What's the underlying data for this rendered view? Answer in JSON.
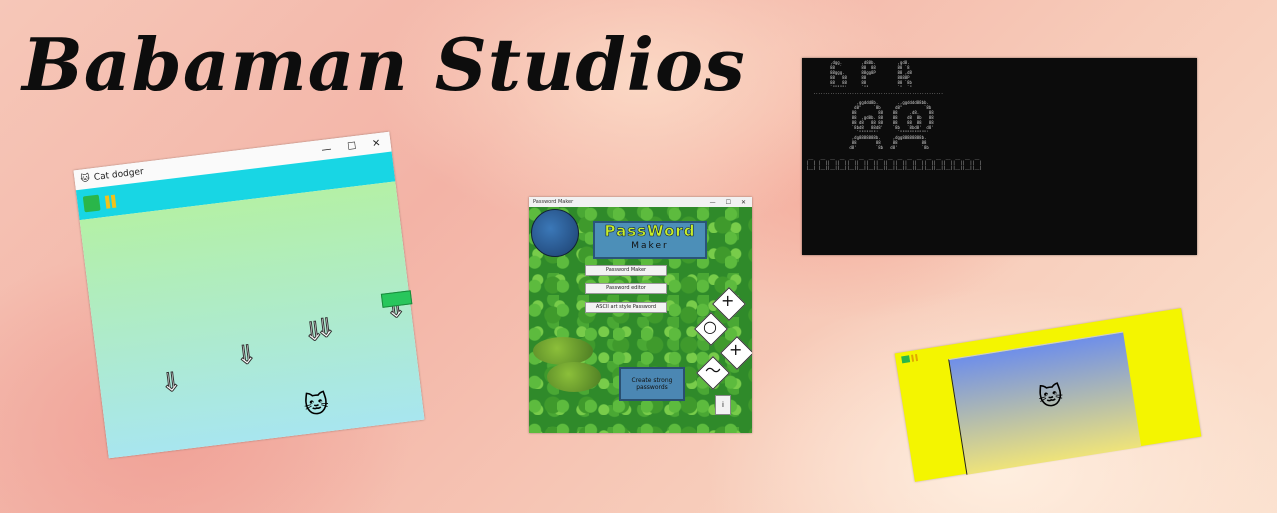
{
  "page": {
    "title": "Babaman Studios"
  },
  "cat_dodger": {
    "window_title": "Cat dodger",
    "controls": [
      "—",
      "☐",
      "✕"
    ],
    "icons": [
      "green-flag-icon",
      "pause-icon"
    ],
    "player_sprite": "scratch-cat",
    "obstacle": "down-arrow"
  },
  "password_maker": {
    "window_title": "Password Maker",
    "controls": [
      "—",
      "☐",
      "✕"
    ],
    "logo_main": "PassWord",
    "logo_sub": "Maker",
    "buttons": [
      "Password Maker",
      "Password editor",
      "ASCII art style Password"
    ],
    "create_button": "Create strong passwords",
    "info_button": "i"
  },
  "terminal": {
    "content": "ascii-art"
  },
  "yellow_stage": {
    "icons": [
      "green-flag-icon",
      "pause-icon"
    ],
    "sprite": "scratch-cat"
  },
  "colors": {
    "cat_dodger_bar": "#18d6e4",
    "yellow_stage": "#f4f500",
    "terminal_bg": "#0c0c0c"
  }
}
